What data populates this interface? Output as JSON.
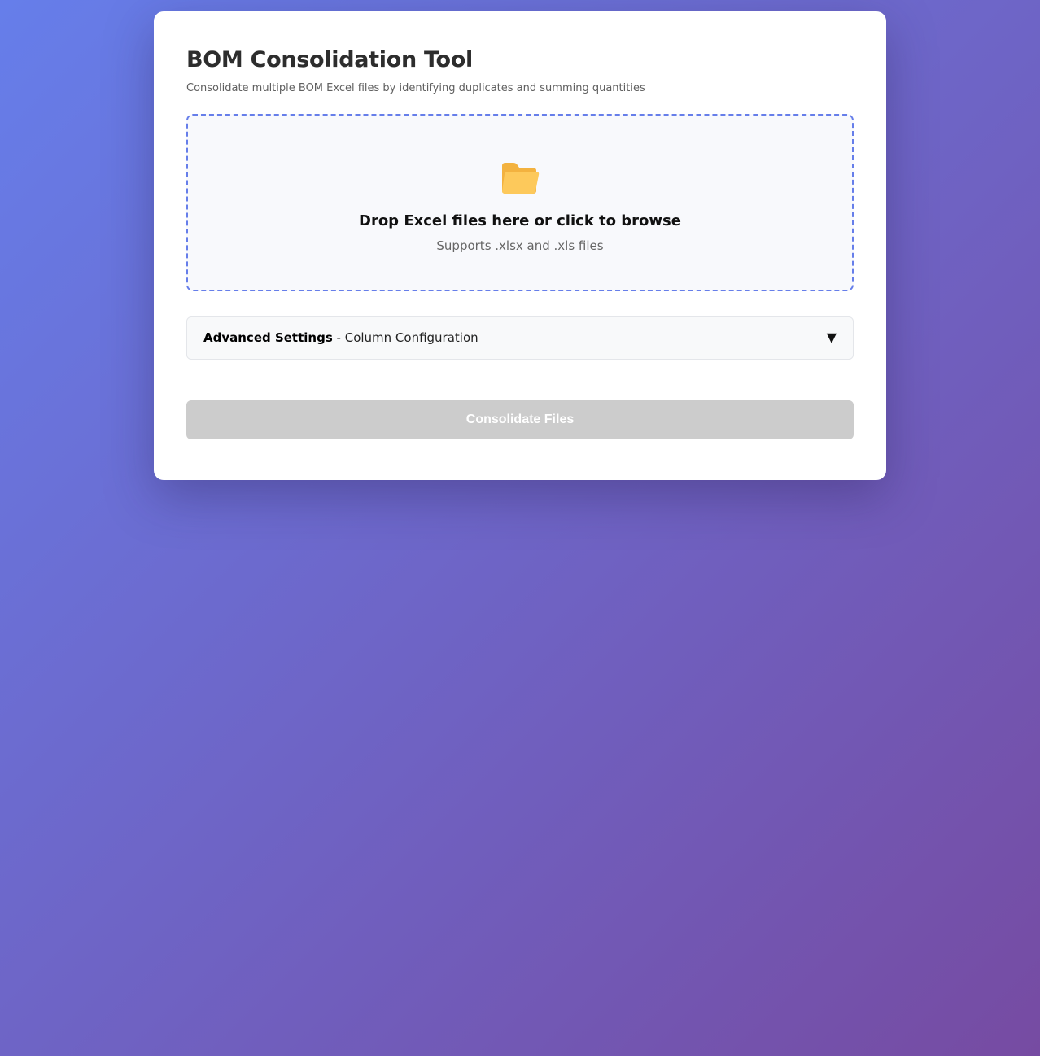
{
  "app": {
    "title": "BOM Consolidation Tool",
    "subtitle": "Consolidate multiple BOM Excel files by identifying duplicates and summing quantities"
  },
  "drop_zone": {
    "icon": "folder-icon",
    "title": "Drop Excel files here or click to browse",
    "hint": "Supports .xlsx and .xls files",
    "border_color": "#667eea"
  },
  "advanced_settings": {
    "label_strong": "Advanced Settings",
    "label_rest": " - Column Configuration",
    "toggle_icon": "▼",
    "expanded": false
  },
  "actions": {
    "consolidate_label": "Consolidate Files",
    "consolidate_enabled": false
  },
  "colors": {
    "gradient_start": "#667eea",
    "gradient_end": "#764ba2",
    "folder": "#fcc95a",
    "button_disabled": "#cccccc"
  }
}
